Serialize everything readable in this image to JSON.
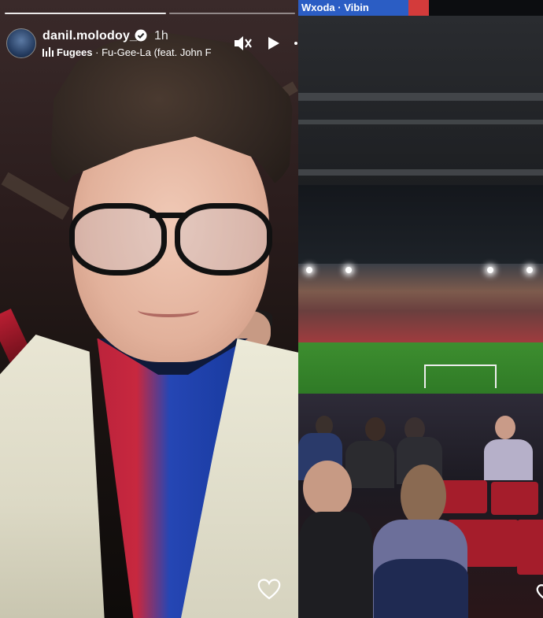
{
  "left_story": {
    "username": "danil.molodoy_",
    "time": "1h",
    "music": {
      "artist": "Fugees",
      "separator": "·",
      "track": "Fu-Gee-La (feat. John F"
    },
    "icons": [
      "verified-badge-icon",
      "music-bars-icon",
      "speaker-muted-icon",
      "play-icon",
      "heart-icon"
    ]
  },
  "right_story": {
    "music_sticker": {
      "artist": "Wxoda",
      "separator": "·",
      "track": "Vibin"
    }
  },
  "colors": {
    "sticker_bg": "#2b5dc4",
    "shirt_red": "#c7283f",
    "shirt_blue": "#1c3ea6",
    "pitch_green": "#3d8e2f"
  }
}
